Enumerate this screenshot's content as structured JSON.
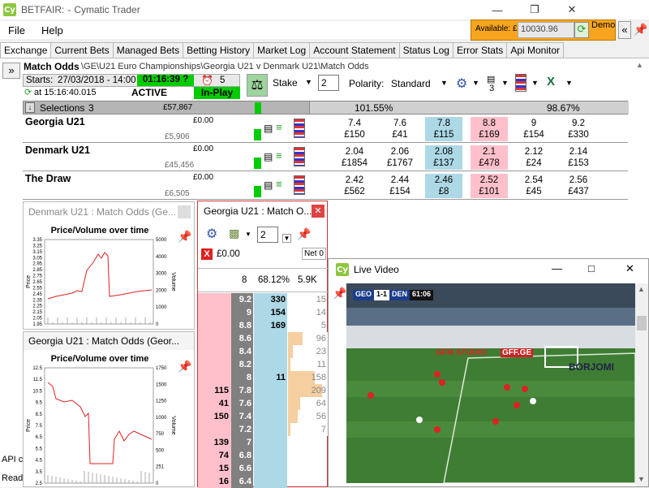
{
  "title": {
    "app": "BETFAIR:",
    "sep": "-",
    "name": "Cymatic Trader"
  },
  "account": {
    "available_label": "Available: £",
    "balance": "10030.96",
    "mode": "Demo"
  },
  "menu": [
    "File",
    "Help"
  ],
  "tabs": [
    "Exchange",
    "Current Bets",
    "Managed Bets",
    "Betting History",
    "Market Log",
    "Account Statement",
    "Status Log",
    "Error Stats",
    "Api Monitor"
  ],
  "market": {
    "name": "Match Odds",
    "path": "\\GE\\U21 Euro Championships\\Georgia U21 v Denmark U21\\Match Odds",
    "starts_label": "Starts:",
    "starts": "27/03/2018 - 14:00",
    "countdown": "01:16:39 ?",
    "timer_count": "5",
    "at_time": "at 15:16:40.015",
    "status": "ACTIVE",
    "inplay": "In-Play",
    "stake_label": "Stake",
    "stake_value": "2",
    "polarity_label": "Polarity:",
    "polarity_value": "Standard",
    "count3": "3",
    "selections_label": "Selections",
    "selections_count": "3",
    "matched": "£57,867",
    "back_overround": "101.55%",
    "lay_overround": "98.67%"
  },
  "runners": [
    {
      "name": "Georgia U21",
      "pl": "£0.00",
      "vol": "£5,906",
      "odds": [
        [
          "7.4",
          "£150"
        ],
        [
          "7.6",
          "£41"
        ],
        [
          "7.8",
          "£115"
        ],
        [
          "8.8",
          "£169"
        ],
        [
          "9",
          "£154"
        ],
        [
          "9.2",
          "£330"
        ]
      ]
    },
    {
      "name": "Denmark U21",
      "pl": "£0.00",
      "vol": "£45,456",
      "odds": [
        [
          "2.04",
          "£1854"
        ],
        [
          "2.06",
          "£1767"
        ],
        [
          "2.08",
          "£137"
        ],
        [
          "2.1",
          "£478"
        ],
        [
          "2.12",
          "£24"
        ],
        [
          "2.14",
          "£153"
        ]
      ]
    },
    {
      "name": "The Draw",
      "pl": "£0.00",
      "vol": "£6,505",
      "odds": [
        [
          "2.42",
          "£562"
        ],
        [
          "2.44",
          "£154"
        ],
        [
          "2.46",
          "£8"
        ],
        [
          "2.52",
          "£101"
        ],
        [
          "2.54",
          "£45"
        ],
        [
          "2.56",
          "£437"
        ]
      ]
    }
  ],
  "chart1": {
    "title": "Denmark U21 : Match Odds (Ge...",
    "heading": "Price/Volume over time",
    "ylabel": "Price",
    "y2label": "Volume",
    "yticks": [
      "3.35",
      "3.25",
      "3.15",
      "3.05",
      "2.95",
      "2.85",
      "2.75",
      "2.65",
      "2.55",
      "2.45",
      "2.35",
      "2.25",
      "2.15",
      "2.05",
      "1.95"
    ],
    "y2ticks": [
      "5000",
      "4000",
      "3000",
      "2000",
      "1000",
      "0"
    ]
  },
  "chart2": {
    "title": "Georgia U21 : Match Odds (Geor...",
    "heading": "Price/Volume over time",
    "ylabel": "Price",
    "y2label": "Volume",
    "yticks": [
      "12.5",
      "11.5",
      "10.5",
      "9.5",
      "8.5",
      "7.5",
      "6.5",
      "5.5",
      "4.5",
      "3.5",
      "2.5"
    ],
    "y2ticks": [
      "1750",
      "1500",
      "1250",
      "1000",
      "750",
      "500",
      "251",
      "0"
    ]
  },
  "ladder": {
    "title": "Georgia U21 : Match O...",
    "stake": "2",
    "pl": "£0.00",
    "net": "Net 0",
    "hdr": [
      "8",
      "68.12%",
      "5.9K"
    ],
    "rows": [
      {
        "b": "",
        "p": "9.2",
        "l": "330",
        "v": "15",
        "w": 0
      },
      {
        "b": "",
        "p": "9",
        "l": "154",
        "v": "14",
        "w": 0
      },
      {
        "b": "",
        "p": "8.8",
        "l": "169",
        "v": "5",
        "w": 0
      },
      {
        "b": "",
        "p": "8.6",
        "l": "",
        "v": "96",
        "w": 6
      },
      {
        "b": "",
        "p": "8.4",
        "l": "",
        "v": "23",
        "w": 2
      },
      {
        "b": "",
        "p": "8.2",
        "l": "",
        "v": "11",
        "w": 1
      },
      {
        "b": "",
        "p": "8",
        "l": "11",
        "v": "158",
        "w": 11
      },
      {
        "b": "115",
        "p": "7.8",
        "l": "",
        "v": "209",
        "w": 14
      },
      {
        "b": "41",
        "p": "7.6",
        "l": "",
        "v": "64",
        "w": 5
      },
      {
        "b": "150",
        "p": "7.4",
        "l": "",
        "v": "56",
        "w": 4
      },
      {
        "b": "",
        "p": "7.2",
        "l": "",
        "v": "7",
        "w": 1
      },
      {
        "b": "139",
        "p": "7",
        "l": "",
        "v": "",
        "w": 0
      },
      {
        "b": "74",
        "p": "6.8",
        "l": "",
        "v": "",
        "w": 0
      },
      {
        "b": "15",
        "p": "6.6",
        "l": "",
        "v": "",
        "w": 0
      },
      {
        "b": "16",
        "p": "6.4",
        "l": "",
        "v": "",
        "w": 0
      }
    ]
  },
  "video": {
    "title": "Live Video",
    "home": "GEO",
    "score": "1-1",
    "away": "DEN",
    "clock": "61:06",
    "board1": "GFF.GE",
    "board2": "BORJOMI",
    "board3": "GFM STUDIO"
  },
  "status": {
    "api": "API c",
    "ready": "Read"
  }
}
